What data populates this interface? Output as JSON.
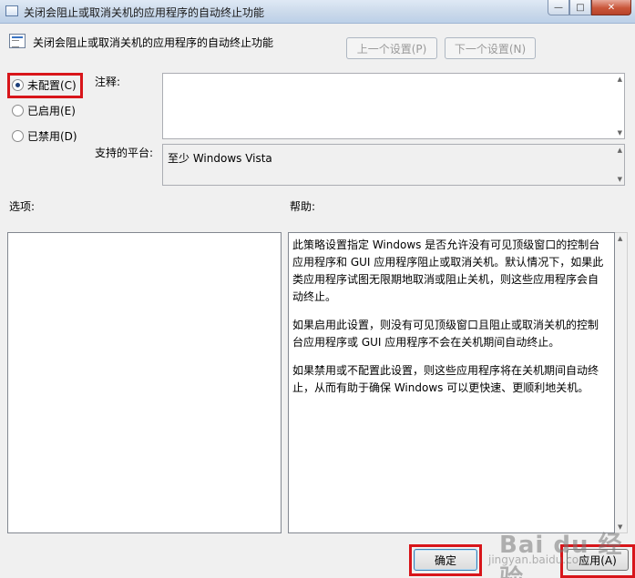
{
  "window": {
    "title": "关闭会阻止或取消关机的应用程序的自动终止功能",
    "controls": {
      "minimize": "—",
      "maximize": "□",
      "close": "✕"
    }
  },
  "header": {
    "policy_title": "关闭会阻止或取消关机的应用程序的自动终止功能",
    "prev_label": "上一个设置(P)",
    "next_label": "下一个设置(N)"
  },
  "state": {
    "options": [
      {
        "label": "未配置(C)",
        "selected": true
      },
      {
        "label": "已启用(E)",
        "selected": false
      },
      {
        "label": "已禁用(D)",
        "selected": false
      }
    ]
  },
  "comment": {
    "label": "注释:",
    "value": ""
  },
  "platform": {
    "label": "支持的平台:",
    "value": "至少 Windows Vista"
  },
  "options_panel": {
    "label": "选项:"
  },
  "help": {
    "label": "帮助:",
    "paragraphs": [
      "此策略设置指定 Windows 是否允许没有可见顶级窗口的控制台应用程序和 GUI 应用程序阻止或取消关机。默认情况下，如果此类应用程序试图无限期地取消或阻止关机，则这些应用程序会自动终止。",
      "如果启用此设置，则没有可见顶级窗口且阻止或取消关机的控制台应用程序或 GUI 应用程序不会在关机期间自动终止。",
      "如果禁用或不配置此设置，则这些应用程序将在关机期间自动终止，从而有助于确保 Windows 可以更快速、更顺利地关机。"
    ]
  },
  "footer": {
    "ok_label": "确定",
    "apply_label": "应用(A)"
  },
  "watermark": {
    "main": "Bai du 经验",
    "sub": "jingyan.baidu.com"
  },
  "colors": {
    "highlight": "#d8151a",
    "title_bar": "#c9d8ea"
  }
}
